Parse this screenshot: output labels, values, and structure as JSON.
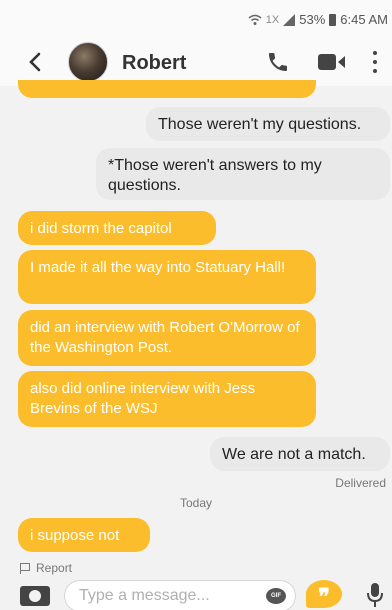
{
  "status_bar": {
    "network": "1X",
    "battery": "53%",
    "time": "6:45 AM"
  },
  "header": {
    "contact_name": "Robert",
    "icons": [
      "back-icon",
      "avatar",
      "call-icon",
      "video-icon",
      "more-icon"
    ]
  },
  "messages": [
    {
      "direction": "outgoing",
      "text": "Those weren't my questions."
    },
    {
      "direction": "outgoing",
      "text": "*Those weren't answers to my questions."
    },
    {
      "direction": "incoming",
      "text": "i did storm the capitol"
    },
    {
      "direction": "incoming",
      "text": "I made it all the way into Statuary Hall!"
    },
    {
      "direction": "incoming",
      "text": "did an interview with Robert O'Morrow of the Washington Post."
    },
    {
      "direction": "incoming",
      "text": "also did online interview with Jess Brevins of the WSJ"
    },
    {
      "direction": "outgoing",
      "text": "We are not a match."
    },
    {
      "direction": "incoming",
      "text": "i suppose not"
    }
  ],
  "delivered_label": "Delivered",
  "date_divider": "Today",
  "report_label": "Report",
  "composer": {
    "placeholder": "Type a message...",
    "gif_label": "GIF"
  },
  "colors": {
    "incoming_bubble": "#fbbd2c",
    "outgoing_bubble": "#e9e9ea"
  }
}
